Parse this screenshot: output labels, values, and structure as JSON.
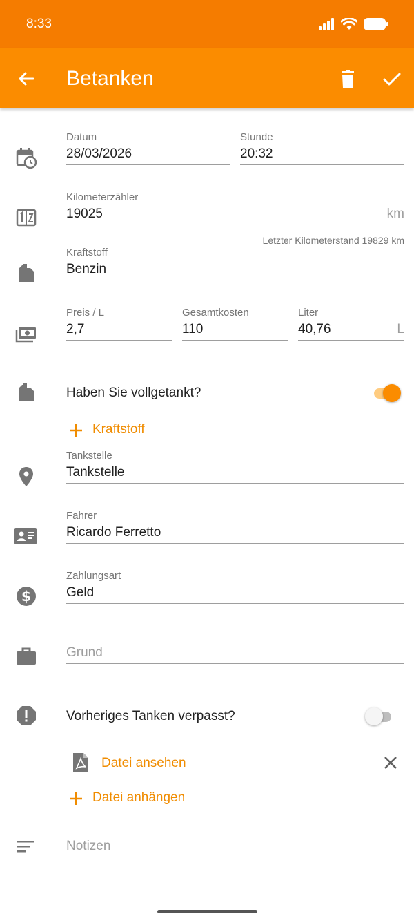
{
  "status": {
    "time": "8:33"
  },
  "appbar": {
    "title": "Betanken"
  },
  "form": {
    "date": {
      "label": "Datum",
      "value": "28/03/2026"
    },
    "hour": {
      "label": "Stunde",
      "value": "20:32"
    },
    "odometer": {
      "label": "Kilometerzähler",
      "value": "19025",
      "unit": "km",
      "helper": "Letzter Kilometerstand 19829 km"
    },
    "fuel": {
      "label": "Kraftstoff",
      "value": "Benzin"
    },
    "price": {
      "label": "Preis / L",
      "value": "2,7"
    },
    "total": {
      "label": "Gesamtkosten",
      "value": "110"
    },
    "liters": {
      "label": "Liter",
      "value": "40,76",
      "unit": "L"
    },
    "full_tank": {
      "label": "Haben Sie vollgetankt?",
      "checked": true
    },
    "add_fuel": {
      "label": "Kraftstoff"
    },
    "station": {
      "label": "Tankstelle",
      "value": "Tankstelle"
    },
    "driver": {
      "label": "Fahrer",
      "value": "Ricardo Ferretto"
    },
    "payment": {
      "label": "Zahlungsart",
      "value": "Geld"
    },
    "reason": {
      "placeholder": "Grund"
    },
    "missed": {
      "label": "Vorheriges Tanken verpasst?",
      "checked": false
    },
    "attachment": {
      "link": "Datei ansehen"
    },
    "attach": {
      "label": "Datei anhängen"
    },
    "notes": {
      "placeholder": "Notizen"
    }
  },
  "colors": {
    "statusbar": "#f57c00",
    "appbar": "#fb8c00",
    "accent": "#f08c00",
    "icon": "#757575"
  }
}
